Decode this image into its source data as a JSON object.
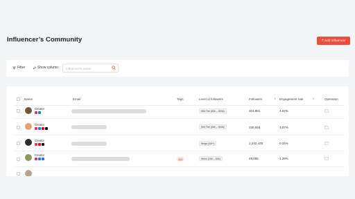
{
  "page": {
    "title": "Influencer’s Community"
  },
  "actions": {
    "add_label": "Add influencer",
    "add_icon": "plus-icon"
  },
  "toolbar": {
    "filter_label": "Filter",
    "filter_icon": "filter-icon",
    "show_column_label": "Show column",
    "show_column_icon": "pencil-icon",
    "search_placeholder": "Influencer's name",
    "search_icon": "search-icon"
  },
  "table": {
    "headers": {
      "name": "Name",
      "email": "Email",
      "tags": "Tags",
      "level": "Level of followers",
      "followers": "Followers",
      "engagement": "Engagement rate",
      "operation": "Operation"
    },
    "rows": [
      {
        "name": "Creator",
        "level": "Mid Tier (50k – 500k)",
        "followers": "401,951",
        "engagement": "4.02%",
        "tag": "",
        "op": "···",
        "avatar_color": "#6b5a3a"
      },
      {
        "name": "Creator",
        "level": "Mid Tier (50k – 500k)",
        "followers": "330,555",
        "engagement": "3.07%",
        "tag": "",
        "op": "···",
        "avatar_color": "#e2a36f"
      },
      {
        "name": "Creator",
        "level": "Mega (1M+)",
        "followers": "1,242,428",
        "engagement": "0.34%",
        "tag": "",
        "op": "···",
        "avatar_color": "#2c2c2c"
      },
      {
        "name": "Creator",
        "level": "Micro (10k – 50k)",
        "followers": "49,095",
        "engagement": "1.28%",
        "tag": "运动",
        "op": "···",
        "avatar_color": "#8a9a5a"
      }
    ]
  },
  "colors": {
    "accent": "#ee4d3d",
    "instagram": "#e1306c",
    "facebook": "#1877f2",
    "youtube": "#ff0000",
    "tiktok": "#111111"
  }
}
